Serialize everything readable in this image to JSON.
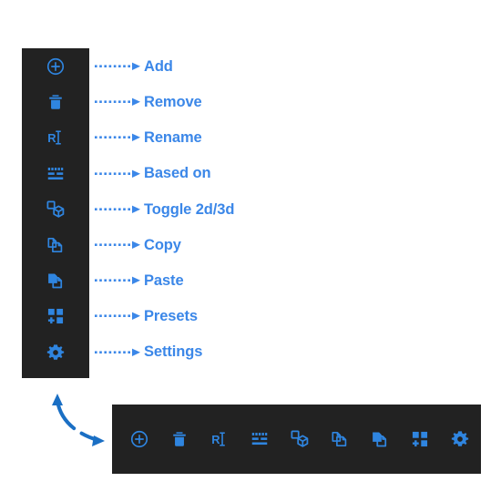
{
  "theme": {
    "panel_bg": "#222222",
    "page_bg": "#ffffff",
    "accent_blue": "#3b87e8",
    "icon_blue": "#2f85e0",
    "arrow_blue": "#1a6fc4"
  },
  "legend": {
    "items": [
      {
        "label": "Add",
        "icon": "add-circle-icon"
      },
      {
        "label": "Remove",
        "icon": "trash-icon"
      },
      {
        "label": "Rename",
        "icon": "rename-text-cursor-icon"
      },
      {
        "label": "Based on",
        "icon": "list-lines-icon"
      },
      {
        "label": "Toggle 2d/3d",
        "icon": "cube-square-icon"
      },
      {
        "label": "Copy",
        "icon": "copy-pages-icon"
      },
      {
        "label": "Paste",
        "icon": "paste-page-icon"
      },
      {
        "label": "Presets",
        "icon": "grid-plus-icon"
      },
      {
        "label": "Settings",
        "icon": "gear-icon"
      }
    ]
  },
  "toolbar": {
    "buttons": [
      {
        "label": "Add",
        "icon": "add-circle-icon"
      },
      {
        "label": "Remove",
        "icon": "trash-icon"
      },
      {
        "label": "Rename",
        "icon": "rename-text-cursor-icon"
      },
      {
        "label": "Based on",
        "icon": "list-lines-icon"
      },
      {
        "label": "Toggle 2d/3d",
        "icon": "cube-square-icon"
      },
      {
        "label": "Copy",
        "icon": "copy-pages-icon"
      },
      {
        "label": "Paste",
        "icon": "paste-page-icon"
      },
      {
        "label": "Presets",
        "icon": "grid-plus-icon"
      },
      {
        "label": "Settings",
        "icon": "gear-icon"
      }
    ]
  },
  "connector": {
    "name": "curved-double-arrow"
  }
}
